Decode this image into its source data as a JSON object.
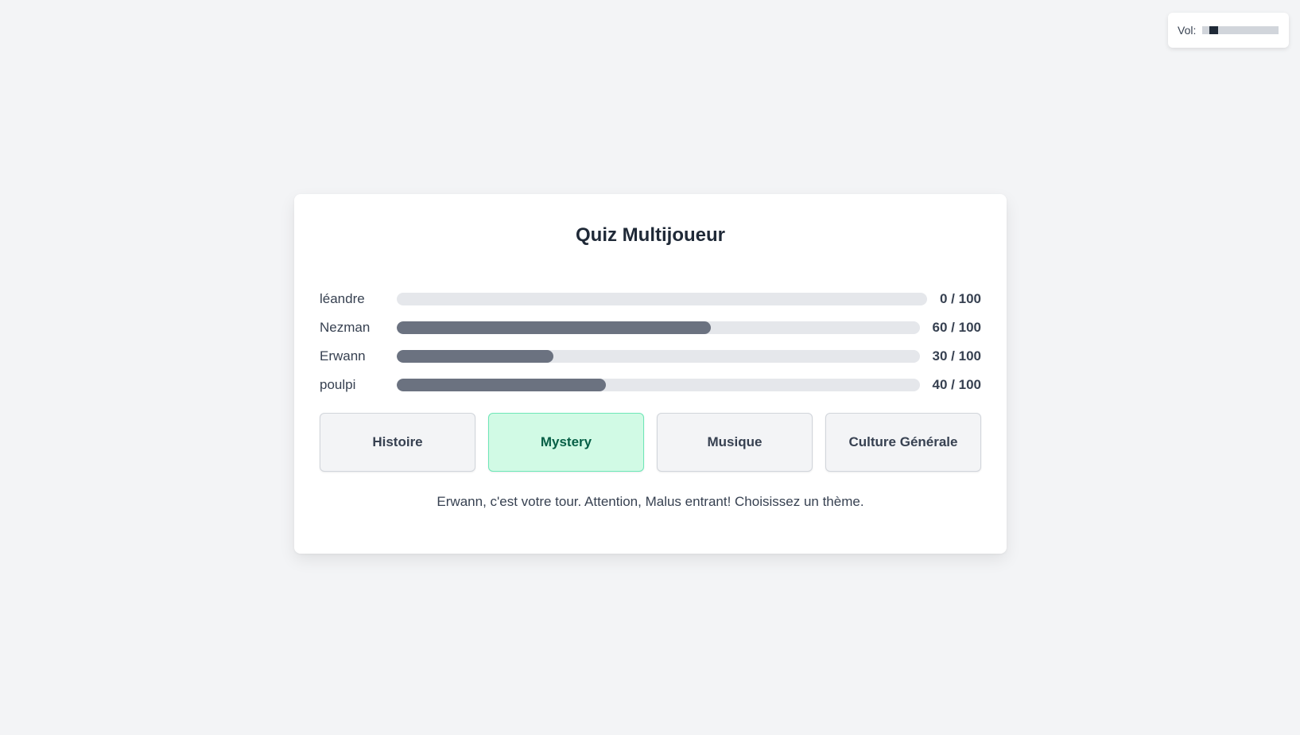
{
  "volume": {
    "label": "Vol:",
    "level": 0.1
  },
  "quiz": {
    "title": "Quiz Multijoueur",
    "players": [
      {
        "name": "léandre",
        "score_text": "0 / 100",
        "progress": 0.0
      },
      {
        "name": "Nezman",
        "score_text": "60 / 100",
        "progress": 0.6
      },
      {
        "name": "Erwann",
        "score_text": "30 / 100",
        "progress": 0.3
      },
      {
        "name": "poulpi",
        "score_text": "40 / 100",
        "progress": 0.4
      }
    ],
    "themes": [
      {
        "label": "Histoire",
        "selected": false
      },
      {
        "label": "Mystery",
        "selected": true
      },
      {
        "label": "Musique",
        "selected": false
      },
      {
        "label": "Culture Générale",
        "selected": false
      }
    ],
    "status": "Erwann, c'est votre tour. Attention, Malus entrant! Choisissez un thème."
  },
  "colors": {
    "page_background": "#f3f4f6",
    "card_background": "#ffffff",
    "progress_fill": "#6b7280",
    "progress_track": "#e5e7eb",
    "selected_theme_bg": "#d1fae5",
    "selected_theme_border": "#6ee7b7",
    "selected_theme_text": "#065f46"
  }
}
